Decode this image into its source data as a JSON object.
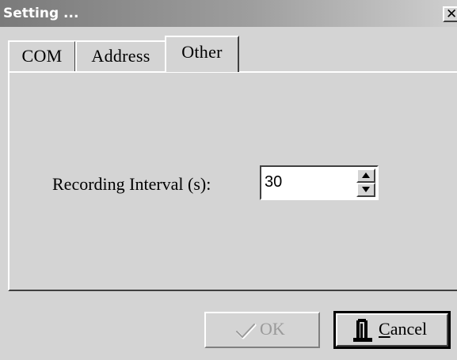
{
  "window": {
    "title": "Setting ...",
    "close_icon": "close-icon"
  },
  "tabs": [
    {
      "label": "COM",
      "active": false
    },
    {
      "label": "Address",
      "active": false
    },
    {
      "label": "Other",
      "active": true
    }
  ],
  "other_tab": {
    "recording_interval_label": "Recording Interval (s):",
    "recording_interval_value": "30"
  },
  "buttons": {
    "ok_label": "OK",
    "ok_icon": "checkmark-icon",
    "ok_enabled": false,
    "cancel_label_mnemonic": "C",
    "cancel_label_rest": "ancel",
    "cancel_icon": "door-exit-icon"
  },
  "colors": {
    "face": "#d4d4d4",
    "title_gradient_start": "#7a7a7a",
    "disabled_text": "#9a9a9a"
  }
}
